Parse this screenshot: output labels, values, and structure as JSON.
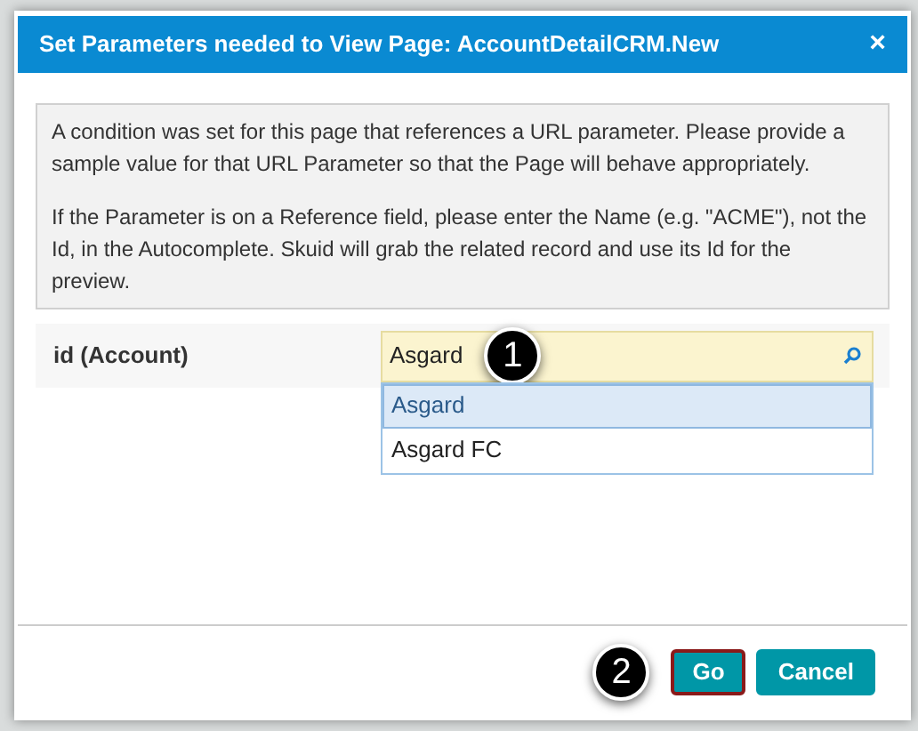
{
  "dialog": {
    "title": "Set Parameters needed to View Page: AccountDetailCRM.New",
    "close": "×",
    "info": [
      "A condition was set for this page that references a URL parameter. Please provide a sample value for that URL Parameter so that the Page will behave appropriately.",
      "If the Parameter is on a Reference field, please enter the Name (e.g. \"ACME\"), not the Id, in the Autocomplete. Skuid will grab the related record and use its Id for the preview."
    ],
    "field": {
      "label": "id (Account)",
      "value": "Asgard",
      "callout": "1"
    },
    "suggestions": [
      {
        "label": "Asgard",
        "selected": true
      },
      {
        "label": "Asgard FC",
        "selected": false
      }
    ],
    "buttons": [
      {
        "label": "Go",
        "focused": true
      },
      {
        "label": "Cancel",
        "focused": false
      }
    ],
    "footer_callout": "2"
  }
}
